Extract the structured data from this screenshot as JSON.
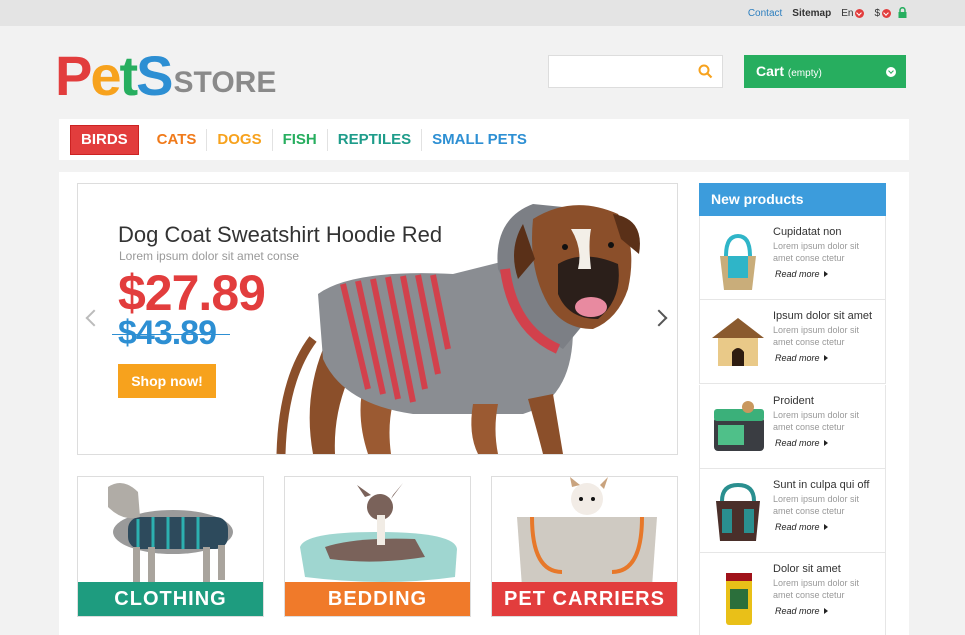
{
  "topbar": {
    "contact": "Contact",
    "sitemap": "Sitemap",
    "language": "En",
    "currency": "$"
  },
  "logo": {
    "letters": [
      "P",
      "e",
      "t",
      "S"
    ],
    "store": "STORE",
    "colors": [
      "#e23d3d",
      "#f7a21d",
      "#27ae5f",
      "#2d8fd3"
    ]
  },
  "search": {
    "placeholder": ""
  },
  "cart": {
    "label": "Cart",
    "status": "(empty)"
  },
  "nav": [
    {
      "label": "BIRDS",
      "color": "#ffffff",
      "active": true
    },
    {
      "label": "CATS",
      "color": "#f07a1a"
    },
    {
      "label": "DOGS",
      "color": "#f7a21d"
    },
    {
      "label": "FISH",
      "color": "#27ae5f"
    },
    {
      "label": "REPTILES",
      "color": "#1e9c8a"
    },
    {
      "label": "SMALL PETS",
      "color": "#2d8fd3"
    }
  ],
  "slider": {
    "title": "Dog Coat Sweatshirt Hoodie Red",
    "subtitle": "Lorem ipsum dolor sit amet conse",
    "price": "$27.89",
    "old_price": "$43.89",
    "button": "Shop now!"
  },
  "categories": [
    {
      "label": "CLOTHING",
      "color": "#1e9c7f"
    },
    {
      "label": "BEDDING",
      "color": "#f07a2a"
    },
    {
      "label": "PET CARRIERS",
      "color": "#e23d3d"
    }
  ],
  "sidebar": {
    "heading": "New products",
    "products": [
      {
        "name": "Cupidatat non",
        "desc": "Lorem ipsum dolor sit amet conse ctetur",
        "more": "Read more"
      },
      {
        "name": "Ipsum dolor sit amet",
        "desc": "Lorem ipsum dolor sit amet conse ctetur",
        "more": "Read more"
      },
      {
        "name": "Proident",
        "desc": "Lorem ipsum dolor sit amet conse ctetur",
        "more": "Read more"
      },
      {
        "name": "Sunt in culpa qui off",
        "desc": "Lorem ipsum dolor sit amet conse ctetur",
        "more": "Read more"
      },
      {
        "name": "Dolor sit amet",
        "desc": "Lorem ipsum dolor sit amet conse ctetur",
        "more": "Read more"
      }
    ]
  }
}
